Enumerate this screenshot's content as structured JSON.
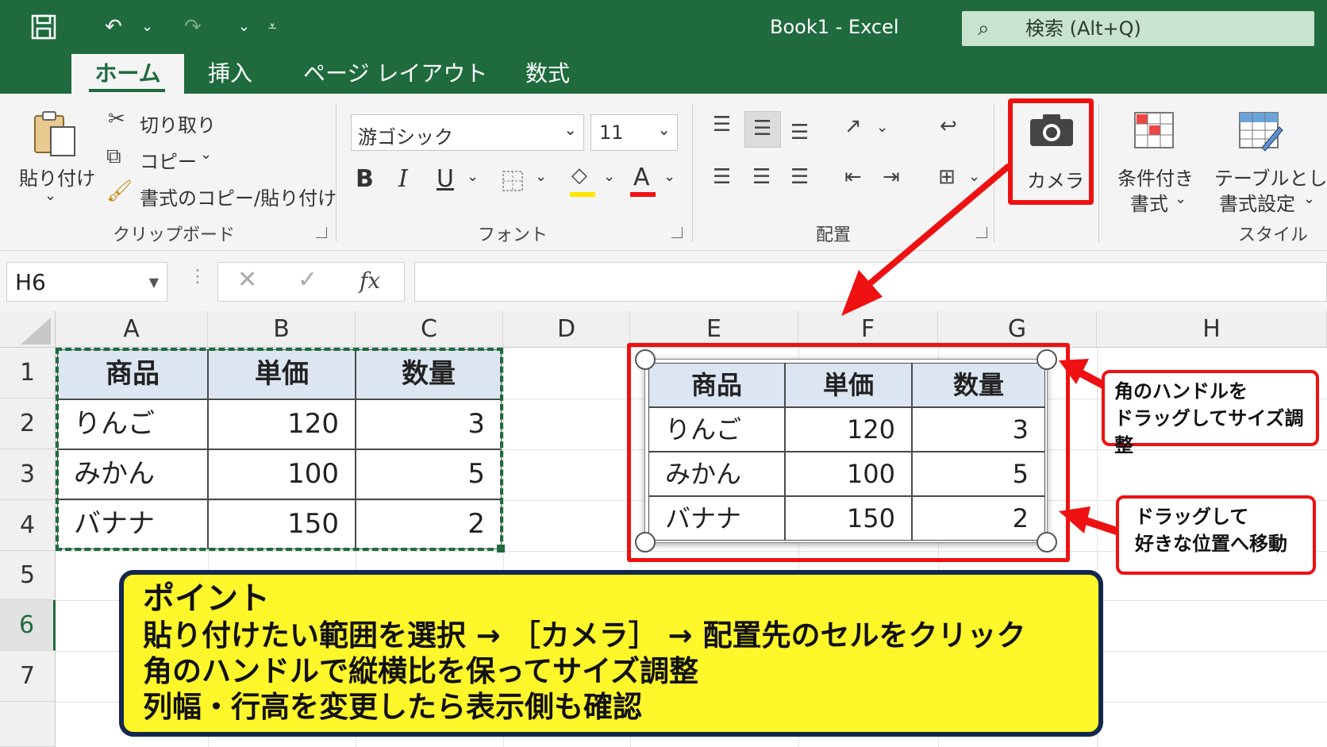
{
  "window": {
    "title": "Book1  -  Excel",
    "search_placeholder": "検索 (Alt+Q)"
  },
  "tabs": [
    "ホーム",
    "挿入",
    "ページ レイアウト",
    "数式"
  ],
  "ribbon": {
    "clipboard": {
      "paste": "貼り付け",
      "cut": "切り取り",
      "copy": "コピー",
      "format_painter": "書式のコピー/貼り付け",
      "label": "クリップボード"
    },
    "font": {
      "name": "游ゴシック",
      "size": "11",
      "bold": "B",
      "italic": "I",
      "underline": "U",
      "font_color_letter": "A",
      "label": "フォント"
    },
    "alignment": {
      "label": "配置"
    },
    "camera": {
      "label": "カメラ"
    },
    "styles": {
      "conditional_line1": "条件付き",
      "conditional_line2": "書式",
      "table_line1": "テーブルとして",
      "table_line2": "書式設定",
      "label": "スタイル"
    }
  },
  "formula_bar": {
    "name_box": "H6",
    "fx": "fx",
    "value": ""
  },
  "sheet": {
    "columns": [
      "A",
      "B",
      "C",
      "D",
      "E",
      "F",
      "G",
      "H"
    ],
    "rows": [
      "1",
      "2",
      "3",
      "4",
      "5",
      "6",
      "7"
    ],
    "selected_row": "6",
    "source_table": {
      "headers": [
        "商品",
        "単価",
        "数量"
      ],
      "rows": [
        [
          "りんご",
          "120",
          "3"
        ],
        [
          "みかん",
          "100",
          "5"
        ],
        [
          "バナナ",
          "150",
          "2"
        ]
      ]
    },
    "picture_table": {
      "headers": [
        "商品",
        "単価",
        "数量"
      ],
      "rows": [
        [
          "りんご",
          "120",
          "3"
        ],
        [
          "みかん",
          "100",
          "5"
        ],
        [
          "バナナ",
          "150",
          "2"
        ]
      ]
    }
  },
  "annotations": {
    "handle_callout_line1": "角のハンドルを",
    "handle_callout_line2": "ドラッグしてサイズ調整",
    "move_callout_line1": "ドラッグして",
    "move_callout_line2": "好きな位置へ移動",
    "point_title": "ポイント",
    "point_lines": [
      "貼り付けたい範囲を選択 → ［カメラ］ → 配置先のセルをクリック",
      "角のハンドルで縦横比を保ってサイズ調整",
      "列幅・行高を変更したら表示側も確認"
    ]
  },
  "colors": {
    "excel_green": "#1f6b3d",
    "highlight_red": "#e11111",
    "point_yellow": "#fff72a",
    "point_border": "#14284e",
    "table_header_fill": "#dce6f2"
  }
}
